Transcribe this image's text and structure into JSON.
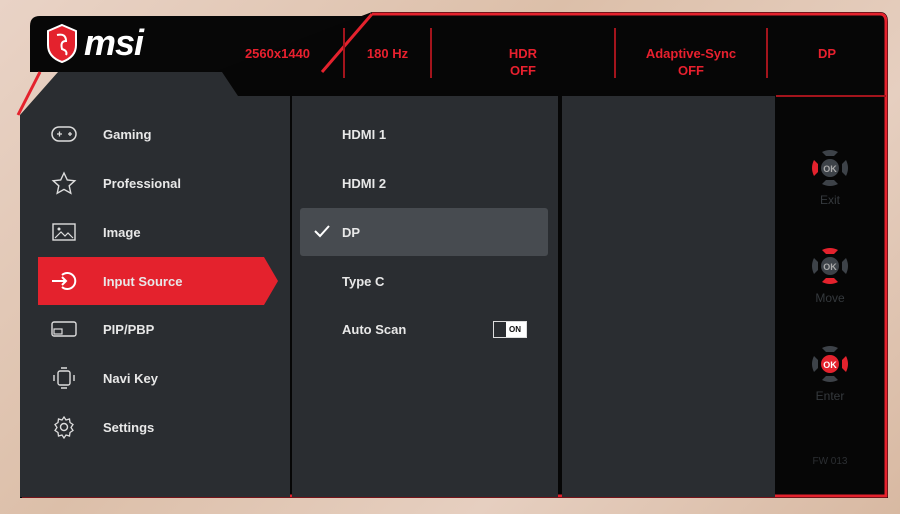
{
  "brand": "msi",
  "status_bar": {
    "resolution": "2560x1440",
    "refresh": "180 Hz",
    "hdr_label": "HDR",
    "hdr_value": "OFF",
    "async_label": "Adaptive-Sync",
    "async_value": "OFF",
    "input": "DP"
  },
  "menu": [
    {
      "label": "Gaming",
      "icon": "gamepad-icon"
    },
    {
      "label": "Professional",
      "icon": "star-icon"
    },
    {
      "label": "Image",
      "icon": "image-icon"
    },
    {
      "label": "Input Source",
      "icon": "input-icon",
      "active": true
    },
    {
      "label": "PIP/PBP",
      "icon": "pip-icon"
    },
    {
      "label": "Navi Key",
      "icon": "navi-key-icon"
    },
    {
      "label": "Settings",
      "icon": "gear-icon"
    }
  ],
  "options": [
    {
      "label": "HDMI 1"
    },
    {
      "label": "HDMI 2"
    },
    {
      "label": "DP",
      "selected": true
    },
    {
      "label": "Type C"
    },
    {
      "label": "Auto Scan",
      "toggle": "ON"
    }
  ],
  "keys": {
    "exit": "Exit",
    "move": "Move",
    "enter": "Enter",
    "ok": "OK"
  },
  "firmware": "FW 013",
  "colors": {
    "accent": "#e4222d",
    "panel": "#2a2d31",
    "background": "#050505"
  }
}
